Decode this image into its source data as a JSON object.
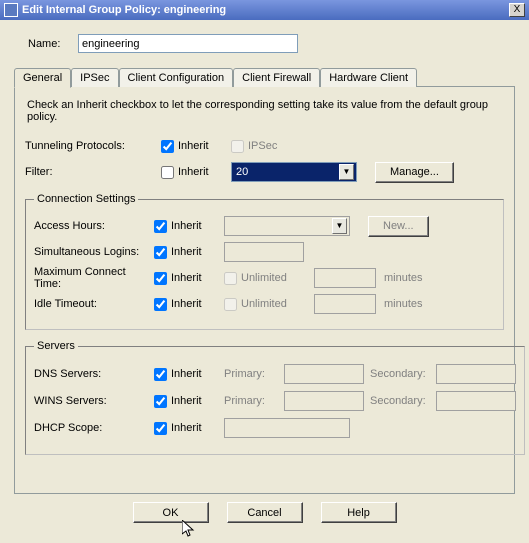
{
  "window": {
    "title": "Edit Internal Group Policy: engineering",
    "close": "X"
  },
  "name": {
    "label": "Name:",
    "value": "engineering"
  },
  "tabs": {
    "items": [
      "General",
      "IPSec",
      "Client Configuration",
      "Client Firewall",
      "Hardware Client"
    ],
    "active": 0
  },
  "instruction": "Check an Inherit checkbox to let the corresponding setting take its value from the default group policy.",
  "fields": {
    "tunneling": {
      "label": "Tunneling Protocols:",
      "inherit": "Inherit",
      "ipsec": "IPSec"
    },
    "filter": {
      "label": "Filter:",
      "inherit": "Inherit",
      "value": "20",
      "manage": "Manage..."
    }
  },
  "conn": {
    "legend": "Connection Settings",
    "access": {
      "label": "Access Hours:",
      "inherit": "Inherit",
      "new": "New..."
    },
    "simul": {
      "label": "Simultaneous Logins:",
      "inherit": "Inherit"
    },
    "maxconn": {
      "label": "Maximum Connect Time:",
      "inherit": "Inherit",
      "unlimited": "Unlimited",
      "unit": "minutes"
    },
    "idle": {
      "label": "Idle Timeout:",
      "inherit": "Inherit",
      "unlimited": "Unlimited",
      "unit": "minutes"
    }
  },
  "servers": {
    "legend": "Servers",
    "dns": {
      "label": "DNS Servers:",
      "inherit": "Inherit",
      "primary": "Primary:",
      "secondary": "Secondary:"
    },
    "wins": {
      "label": "WINS Servers:",
      "inherit": "Inherit",
      "primary": "Primary:",
      "secondary": "Secondary:"
    },
    "dhcp": {
      "label": "DHCP Scope:",
      "inherit": "Inherit"
    }
  },
  "buttons": {
    "ok": "OK",
    "cancel": "Cancel",
    "help": "Help"
  }
}
